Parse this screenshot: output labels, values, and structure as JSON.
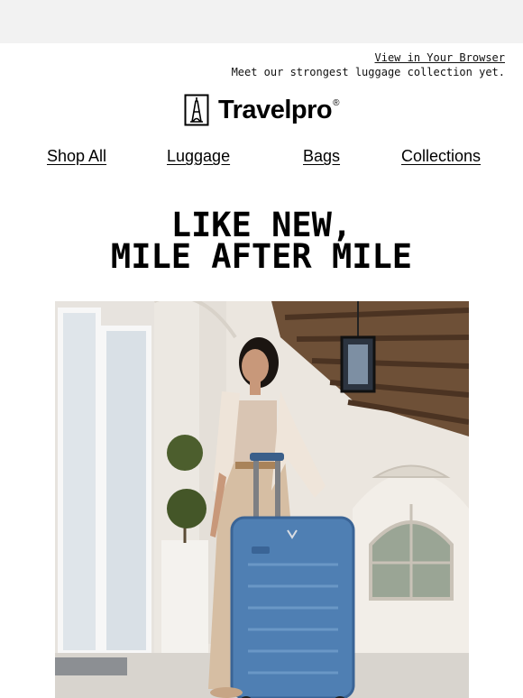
{
  "preheader": {
    "view_in_browser": "View in Your Browser",
    "tagline": "Meet our strongest luggage collection yet."
  },
  "brand": {
    "name": "Travelpro",
    "registered_mark": "®",
    "logo_icon": "eiffel-tower-icon"
  },
  "nav": {
    "items": [
      {
        "label": "Shop All"
      },
      {
        "label": "Luggage"
      },
      {
        "label": "Bags"
      },
      {
        "label": "Collections"
      }
    ]
  },
  "hero": {
    "headline_line1": "LIKE NEW,",
    "headline_line2": "MILE AFTER MILE"
  },
  "colors": {
    "page_background": "#f2f2f2",
    "email_background": "#ffffff",
    "text": "#000000",
    "suitcase_blue": "#4f7fb3"
  }
}
